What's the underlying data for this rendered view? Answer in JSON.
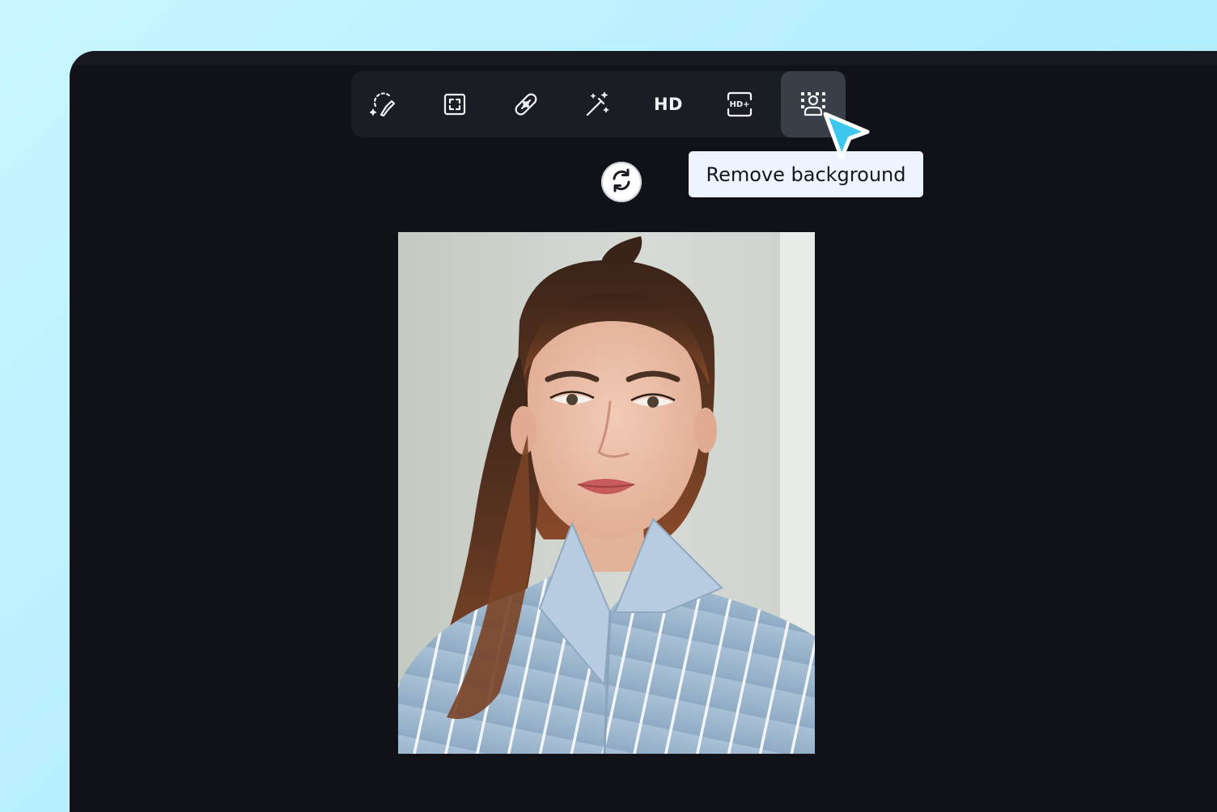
{
  "toolbar": {
    "tools": [
      {
        "name": "ai-brush-icon"
      },
      {
        "name": "crop-expand-icon"
      },
      {
        "name": "bandage-icon"
      },
      {
        "name": "magic-wand-icon"
      },
      {
        "name": "hd-icon",
        "label": "HD"
      },
      {
        "name": "hd-plus-icon",
        "label": "HD+"
      },
      {
        "name": "remove-background-icon"
      }
    ],
    "active_tool": "remove-background-icon"
  },
  "tooltip": {
    "text": "Remove background"
  },
  "refresh": {
    "icon": "refresh-icon"
  },
  "colors": {
    "page_background": "#b4eeff",
    "app_background": "#101218",
    "toolbar_background": "#1a1d24",
    "active_tool_background": "#3a3e47",
    "cursor_color": "#3ec8f0",
    "tooltip_background": "#eef4ff"
  }
}
